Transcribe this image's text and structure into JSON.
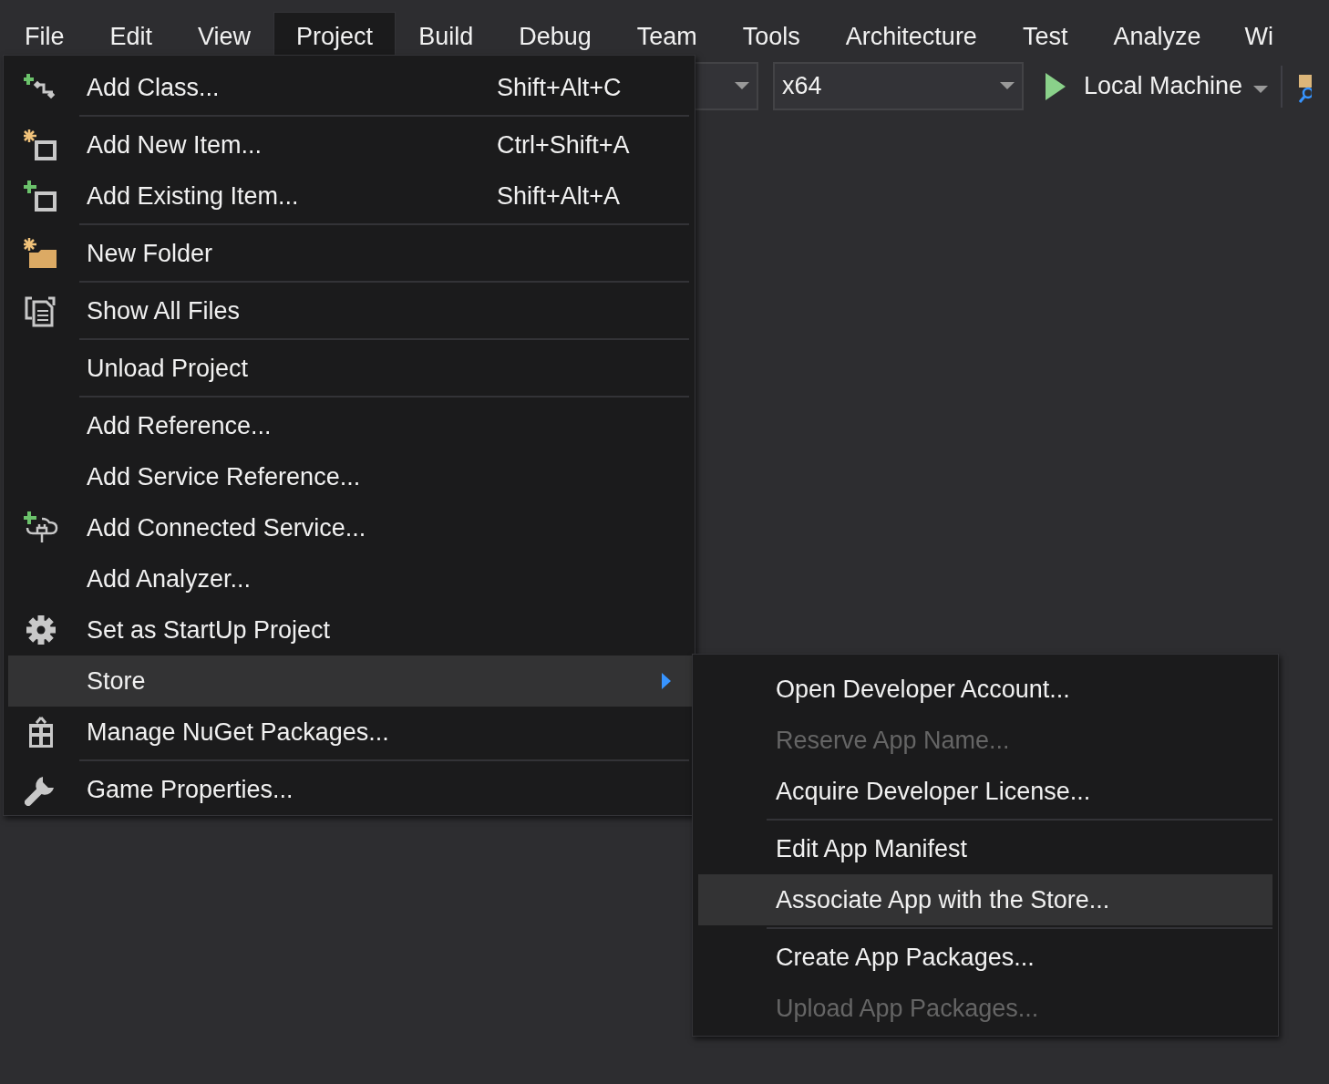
{
  "menubar": [
    {
      "label": "File",
      "selected": false
    },
    {
      "label": "Edit",
      "selected": false
    },
    {
      "label": "View",
      "selected": false
    },
    {
      "label": "Project",
      "selected": true
    },
    {
      "label": "Build",
      "selected": false
    },
    {
      "label": "Debug",
      "selected": false
    },
    {
      "label": "Team",
      "selected": false
    },
    {
      "label": "Tools",
      "selected": false
    },
    {
      "label": "Architecture",
      "selected": false
    },
    {
      "label": "Test",
      "selected": false
    },
    {
      "label": "Analyze",
      "selected": false
    },
    {
      "label": "Wi",
      "selected": false
    }
  ],
  "toolbar": {
    "platform": "x64",
    "run_target": "Local Machine"
  },
  "project_menu": [
    {
      "kind": "item",
      "label": "Add Class...",
      "shortcut": "Shift+Alt+C",
      "selected": false
    },
    {
      "kind": "separator"
    },
    {
      "kind": "item",
      "label": "Add New Item...",
      "shortcut": "Ctrl+Shift+A",
      "selected": false
    },
    {
      "kind": "item",
      "label": "Add Existing Item...",
      "shortcut": "Shift+Alt+A",
      "selected": false
    },
    {
      "kind": "separator"
    },
    {
      "kind": "item",
      "label": "New Folder",
      "selected": false
    },
    {
      "kind": "separator"
    },
    {
      "kind": "item",
      "label": "Show All Files",
      "selected": false
    },
    {
      "kind": "separator"
    },
    {
      "kind": "item",
      "label": "Unload Project",
      "selected": false
    },
    {
      "kind": "separator"
    },
    {
      "kind": "item",
      "label": "Add Reference...",
      "selected": false
    },
    {
      "kind": "item",
      "label": "Add Service Reference...",
      "selected": false
    },
    {
      "kind": "item",
      "label": "Add Connected Service...",
      "selected": false
    },
    {
      "kind": "item",
      "label": "Add Analyzer...",
      "selected": false
    },
    {
      "kind": "item",
      "label": "Set as StartUp Project",
      "selected": false
    },
    {
      "kind": "submenu",
      "label": "Store",
      "selected": true
    },
    {
      "kind": "item",
      "label": "Manage NuGet Packages...",
      "selected": false
    },
    {
      "kind": "separator"
    },
    {
      "kind": "item",
      "label": "Game Properties...",
      "selected": false
    }
  ],
  "store_submenu": [
    {
      "kind": "item",
      "label": "Open Developer Account...",
      "disabled": false,
      "selected": false
    },
    {
      "kind": "item",
      "label": "Reserve App Name...",
      "disabled": true,
      "selected": false
    },
    {
      "kind": "item",
      "label": "Acquire Developer License...",
      "disabled": false,
      "selected": false
    },
    {
      "kind": "separator"
    },
    {
      "kind": "item",
      "label": "Edit App Manifest",
      "disabled": false,
      "selected": false
    },
    {
      "kind": "item",
      "label": "Associate App with the Store...",
      "disabled": false,
      "selected": true
    },
    {
      "kind": "separator"
    },
    {
      "kind": "item",
      "label": "Create App Packages...",
      "disabled": false,
      "selected": false
    },
    {
      "kind": "item",
      "label": "Upload App Packages...",
      "disabled": true,
      "selected": false
    }
  ]
}
